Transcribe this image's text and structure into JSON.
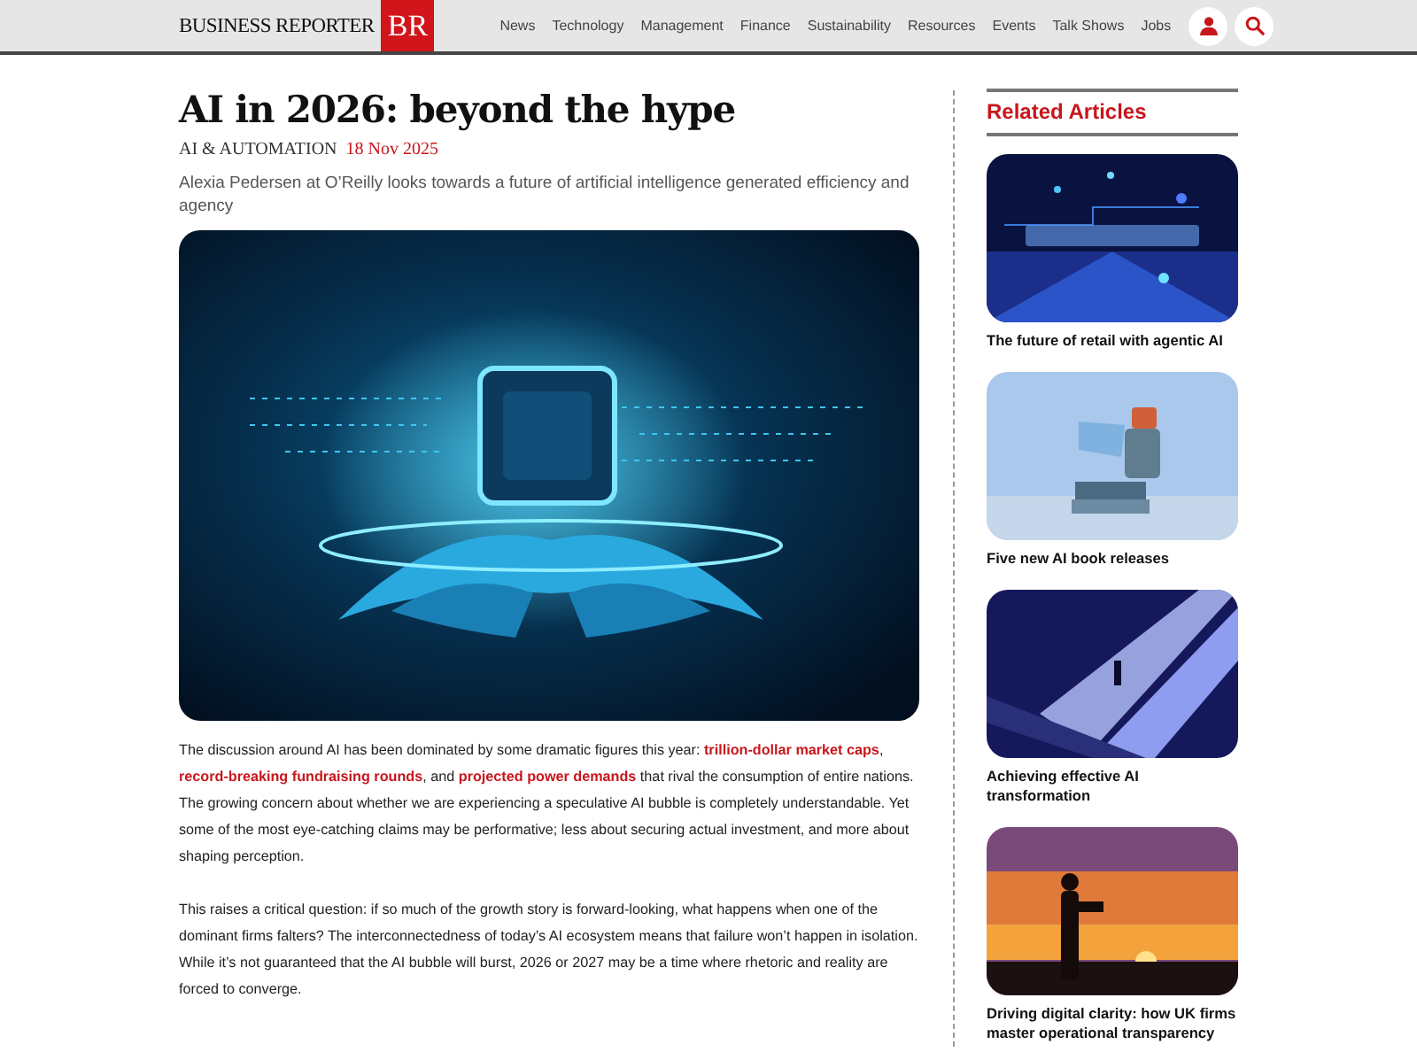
{
  "header": {
    "logo_text": "BUSINESS REPORTER",
    "logo_mark": "BR",
    "nav": [
      {
        "label": "News"
      },
      {
        "label": "Technology"
      },
      {
        "label": "Management"
      },
      {
        "label": "Finance"
      },
      {
        "label": "Sustainability"
      },
      {
        "label": "Resources"
      },
      {
        "label": "Events"
      },
      {
        "label": "Talk Shows"
      },
      {
        "label": "Jobs"
      }
    ]
  },
  "article": {
    "title": "AI in 2026: beyond the hype",
    "category": "AI & AUTOMATION",
    "date": "18 Nov 2025",
    "standfirst": "Alexia Pedersen at O’Reilly looks towards a future of artificial intelligence generated efficiency and agency",
    "hero": {
      "kind": "picture"
    },
    "paragraphs": [
      [
        {
          "kind": "text",
          "text": "The discussion around AI has been dominated by some dramatic figures this year: "
        },
        {
          "kind": "link",
          "text": "trillion-dollar market caps"
        },
        {
          "kind": "text",
          "text": ", "
        },
        {
          "kind": "link",
          "text": "record-breaking fundraising rounds"
        },
        {
          "kind": "text",
          "text": ", and "
        },
        {
          "kind": "link",
          "text": "projected power demands"
        },
        {
          "kind": "text",
          "text": " that rival the consumption of entire nations. The growing concern about whether we are experiencing a speculative AI bubble is completely understandable. Yet some of the most eye-catching claims may be performative; less about securing actual investment, and more about shaping perception."
        }
      ],
      [
        {
          "kind": "text",
          "text": "This raises a critical question: if so much of the growth story is forward-looking, what happens when one of the dominant firms falters? The interconnectedness of today’s AI ecosystem means that failure won’t happen in isolation. While it’s not guaranteed that the AI bubble will burst, 2026 or 2027 may be a time where rhetoric and reality are forced to converge."
        }
      ]
    ]
  },
  "sidebar": {
    "heading": "Related Articles",
    "articles": [
      {
        "title": "The future of retail with agentic AI",
        "thumbnail": {
          "kind": "picture"
        }
      },
      {
        "title": "Five new AI book releases",
        "thumbnail": {
          "kind": "picture"
        }
      },
      {
        "title": "Achieving effective AI transformation",
        "thumbnail": {
          "kind": "picture"
        }
      },
      {
        "title": "Driving digital clarity: how UK firms master operational transparency",
        "thumbnail": {
          "kind": "picture"
        }
      }
    ]
  }
}
